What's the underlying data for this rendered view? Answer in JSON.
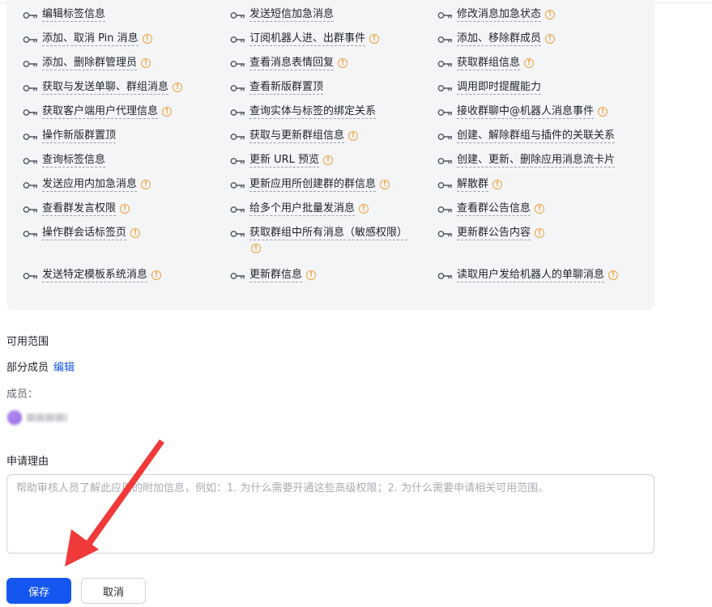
{
  "permissions": [
    {
      "label": "编辑标签信息",
      "info": false
    },
    {
      "label": "发送短信加急消息",
      "info": false
    },
    {
      "label": "修改消息加急状态",
      "info": true
    },
    {
      "label": "添加、取消 Pin 消息",
      "info": true
    },
    {
      "label": "订阅机器人进、出群事件",
      "info": true
    },
    {
      "label": "添加、移除群成员",
      "info": true
    },
    {
      "label": "添加、删除群管理员",
      "info": true
    },
    {
      "label": "查看消息表情回复",
      "info": true
    },
    {
      "label": "获取群组信息",
      "info": true
    },
    {
      "label": "获取与发送单聊、群组消息",
      "info": true
    },
    {
      "label": "查看新版群置顶",
      "info": false
    },
    {
      "label": "调用即时提醒能力",
      "info": false
    },
    {
      "label": "获取客户端用户代理信息",
      "info": true
    },
    {
      "label": "查询实体与标签的绑定关系",
      "info": false
    },
    {
      "label": "接收群聊中@机器人消息事件",
      "info": true
    },
    {
      "label": "操作新版群置顶",
      "info": false
    },
    {
      "label": "获取与更新群组信息",
      "info": true
    },
    {
      "label": "创建、解除群组与插件的关联关系",
      "info": false
    },
    {
      "label": "查询标签信息",
      "info": false
    },
    {
      "label": "更新 URL 预览",
      "info": true
    },
    {
      "label": "创建、更新、删除应用消息流卡片",
      "info": false
    },
    {
      "label": "发送应用内加急消息",
      "info": true
    },
    {
      "label": "更新应用所创建群的群信息",
      "info": true
    },
    {
      "label": "解散群",
      "info": true
    },
    {
      "label": "查看群发言权限",
      "info": true
    },
    {
      "label": "给多个用户批量发消息",
      "info": true
    },
    {
      "label": "查看群公告信息",
      "info": true
    },
    {
      "label": "操作群会话标签页",
      "info": true
    },
    {
      "label": "获取群组中所有消息（敏感权限）",
      "info": true
    },
    {
      "label": "更新群公告内容",
      "info": true
    },
    {
      "label": "发送特定模板系统消息",
      "info": true
    },
    {
      "label": "更新群信息",
      "info": true
    },
    {
      "label": "读取用户发给机器人的单聊消息",
      "info": true
    }
  ],
  "info_glyph": "!",
  "scope": {
    "title": "可用范围",
    "value": "部分成员",
    "edit_label": "编辑",
    "members_label": "成员："
  },
  "reason": {
    "title": "申请理由",
    "placeholder": "帮助审核人员了解此应用的附加信息，例如：1. 为什么需要开通这些高级权限；2. 为什么需要申请相关可用范围。"
  },
  "actions": {
    "save_label": "保存",
    "cancel_label": "取消"
  },
  "colors": {
    "primary": "#1456f0",
    "warning": "#f0a23a",
    "annotation_arrow": "#f03a3a"
  }
}
